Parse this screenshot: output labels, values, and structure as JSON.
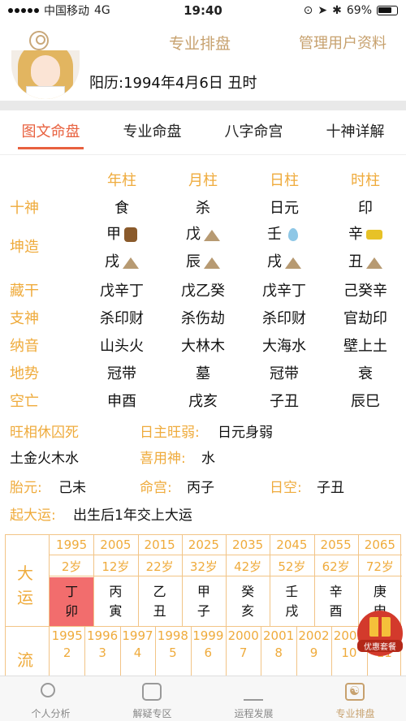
{
  "status_bar": {
    "carrier": "中国移动",
    "network": "4G",
    "time": "19:40",
    "battery": "69%"
  },
  "nav": {
    "title": "专业排盘",
    "manage": "管理用户资料"
  },
  "profile": {
    "solar_date": "阳历:1994年4月6日 丑时"
  },
  "tabs": [
    {
      "label": "图文命盘",
      "active": true
    },
    {
      "label": "专业命盘",
      "active": false
    },
    {
      "label": "八字命宫",
      "active": false
    },
    {
      "label": "十神详解",
      "active": false
    }
  ],
  "pillars": {
    "headers": [
      "年柱",
      "月柱",
      "日柱",
      "时柱"
    ],
    "rows": [
      {
        "label": "十神",
        "values": [
          "食",
          "杀",
          "日元",
          "印"
        ]
      },
      {
        "label": "坤造",
        "values": [
          "甲",
          "戊",
          "壬",
          "辛"
        ],
        "icons": [
          "wood-icon",
          "mountain-icon",
          "water-drop-icon",
          "gold-ingot-icon"
        ]
      },
      {
        "label": "",
        "values": [
          "戌",
          "辰",
          "戌",
          "丑"
        ],
        "icons": [
          "mountain-icon",
          "mountain-icon",
          "mountain-icon",
          "mountain-icon"
        ]
      },
      {
        "label": "藏干",
        "values": [
          "戊辛丁",
          "戊乙癸",
          "戊辛丁",
          "己癸辛"
        ]
      },
      {
        "label": "支神",
        "values": [
          "杀印财",
          "杀伤劫",
          "杀印财",
          "官劫印"
        ]
      },
      {
        "label": "纳音",
        "values": [
          "山头火",
          "大林木",
          "大海水",
          "壁上土"
        ]
      },
      {
        "label": "地势",
        "values": [
          "冠带",
          "墓",
          "冠带",
          "衰"
        ]
      },
      {
        "label": "空亡",
        "values": [
          "申酉",
          "戌亥",
          "子丑",
          "辰巳"
        ]
      }
    ]
  },
  "info": {
    "wangxiang_label": "旺相休囚死",
    "wangxiang_value": "土金火木水",
    "strength_label": "日主旺弱:",
    "strength_value": "日元身弱",
    "xiyong_label": "喜用神:",
    "xiyong_value": "水",
    "taiyuan_label": "胎元:",
    "taiyuan_value": "己未",
    "minggong_label": "命宫:",
    "minggong_value": "丙子",
    "rikong_label": "日空:",
    "rikong_value": "子丑",
    "qiyun_label": "起大运:",
    "qiyun_value": "出生后1年交上大运"
  },
  "dayun": {
    "label_top": "大运",
    "label_bottom": "流",
    "years": [
      "1995",
      "2005",
      "2015",
      "2025",
      "2035",
      "2045",
      "2055",
      "2065"
    ],
    "ages": [
      "2岁",
      "12岁",
      "22岁",
      "32岁",
      "42岁",
      "52岁",
      "62岁",
      "72岁"
    ],
    "ganzhi_top": [
      "丁",
      "丙",
      "乙",
      "甲",
      "癸",
      "壬",
      "辛",
      "庚"
    ],
    "ganzhi_bottom": [
      "卯",
      "寅",
      "丑",
      "子",
      "亥",
      "戌",
      "酉",
      "申"
    ],
    "liunian_years": [
      "1995",
      "1996",
      "1997",
      "1998",
      "1999",
      "2000",
      "2001",
      "2002",
      "2003",
      "2004"
    ],
    "liunian_ages": [
      "2",
      "3",
      "4",
      "5",
      "6",
      "7",
      "8",
      "9",
      "10",
      "11"
    ]
  },
  "promo": {
    "label": "优惠套餐"
  },
  "bottom_tabs": [
    {
      "label": "个人分析",
      "icon": "magnifier-icon"
    },
    {
      "label": "解疑专区",
      "icon": "chat-bubble-icon"
    },
    {
      "label": "运程发展",
      "icon": "line-graph-icon"
    },
    {
      "label": "专业排盘",
      "icon": "taiji-icon"
    }
  ]
}
